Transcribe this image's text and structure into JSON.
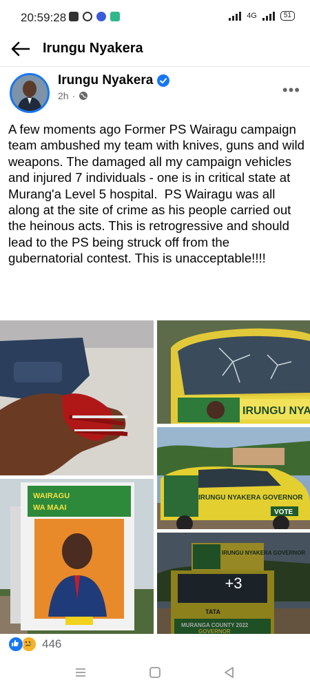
{
  "status_bar": {
    "time": "20:59:28",
    "network": "4G",
    "battery": "51"
  },
  "header": {
    "back_icon": "arrow-left-icon",
    "title": "Irungu Nyakera"
  },
  "post": {
    "author": "Irungu Nyakera",
    "verified": true,
    "time_ago": "2h",
    "privacy_icon": "globe-icon",
    "text": "A few moments ago Former PS Wairagu campaign team ambushed my team with knives, guns and wild weapons. The damaged all my campaign vehicles and injured 7 individuals - one is in critical state at Murang'a Level 5 hospital.  PS Wairagu was all along at the site of crime as his people carried out the heinous acts. This is retrogressive and should lead to the PS being struck off from the gubernatorial contest. This is unacceptable!!!!",
    "photos": {
      "p2_banner": "IRUNGU NYA",
      "p3_plate": "VOTE",
      "p3_door": "IRUNGU NYAKERA GOVERNOR",
      "p4_top": "WAIRAGU",
      "p4_slogan": "WA MAAI",
      "p5_banner": "IRUNGU NYAKERA GOVERNOR",
      "p5_brand": "TATA",
      "p5_bottom": "MURANGA COUNTY 2022",
      "p5_sub": "GOVERNOR",
      "more_count": "+3"
    },
    "reaction_count": "446"
  },
  "nav_bar": {
    "items": [
      "menu-icon",
      "home-square-icon",
      "back-triangle-icon"
    ]
  },
  "colors": {
    "accent": "#1877f2",
    "secondary_text": "#65676b",
    "sad_reaction": "#f7b125"
  }
}
